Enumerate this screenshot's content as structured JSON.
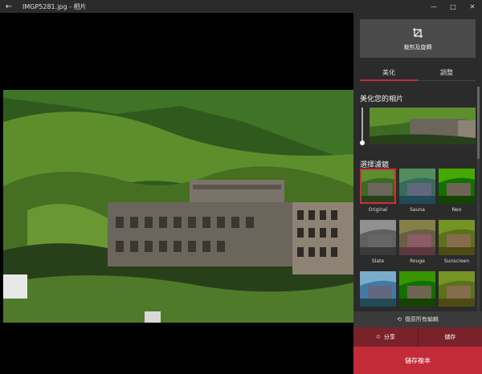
{
  "titlebar": {
    "back_icon": "←",
    "title": "IMGP5281.jpg - 相片",
    "minimize_icon": "—",
    "maximize_icon": "□",
    "close_icon": "✕"
  },
  "panel": {
    "crop_label": "裁剪及旋轉",
    "tabs": [
      "美化",
      "調整"
    ],
    "enhance_title": "美化您的相片",
    "filters_title": "選擇濾鏡",
    "filters": [
      "Original",
      "Sauna",
      "Neo",
      "Slate",
      "Rouge",
      "Sunscreen"
    ],
    "undo_label": "復原所有編輯",
    "share_label": "分享",
    "save_label": "儲存",
    "save_copy_label": "儲存複本"
  },
  "colors": {
    "accent": "#c42b38",
    "panel_bg": "#2b2b2b"
  }
}
